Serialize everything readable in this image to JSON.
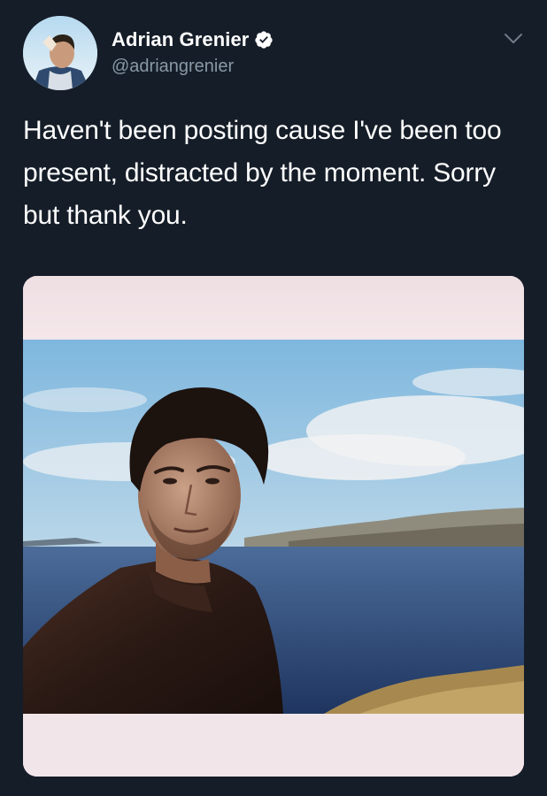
{
  "author": {
    "display_name": "Adrian Grenier",
    "handle": "@adriangrenier",
    "verified": true
  },
  "tweet": {
    "text": "Haven't been posting cause I've been too present, distracted by the moment. Sorry but thank you."
  },
  "icons": {
    "verified": "verified-badge-icon",
    "menu": "chevron-down-icon"
  },
  "colors": {
    "background": "#151d28",
    "text_primary": "#ffffff",
    "text_secondary": "#8899a6",
    "photo_border": "#efe1e5"
  }
}
